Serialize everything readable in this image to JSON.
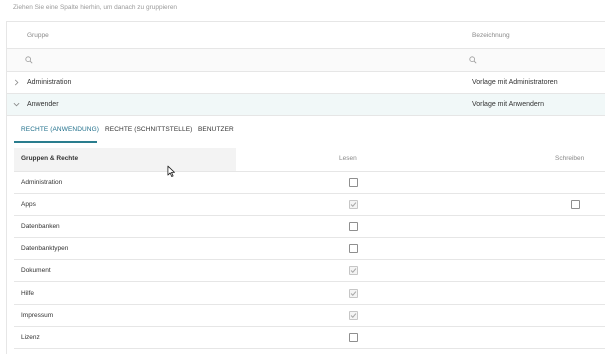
{
  "group_hint": "Ziehen Sie eine Spalte hierhin, um danach zu gruppieren",
  "columns": {
    "gruppe": "Gruppe",
    "bezeichnung": "Bezeichnung"
  },
  "groups": [
    {
      "name": "Administration",
      "description": "Vorlage mit Administratoren",
      "expanded": false
    },
    {
      "name": "Anwender",
      "description": "Vorlage mit Anwendern",
      "expanded": true
    }
  ],
  "tabs": [
    {
      "label": "RECHTE (ANWENDUNG)",
      "active": true
    },
    {
      "label": "RECHTE (SCHNITTSTELLE)",
      "active": false
    },
    {
      "label": "BENUTZER",
      "active": false
    }
  ],
  "rights_header": {
    "group": "Gruppen & Rechte",
    "read": "Lesen",
    "write": "Schreiben"
  },
  "rights": [
    {
      "name": "Administration",
      "read": false,
      "write": null
    },
    {
      "name": "Apps",
      "read": true,
      "write": false
    },
    {
      "name": "Datenbanken",
      "read": false,
      "write": null
    },
    {
      "name": "Datenbanktypen",
      "read": false,
      "write": null
    },
    {
      "name": "Dokument",
      "read": true,
      "write": null
    },
    {
      "name": "Hilfe",
      "read": true,
      "write": null
    },
    {
      "name": "Impressum",
      "read": true,
      "write": null
    },
    {
      "name": "Lizenz",
      "read": false,
      "write": null
    }
  ],
  "icons": {
    "search": "search-icon",
    "collapsed": "chevron-right-icon",
    "expanded": "chevron-down-icon",
    "cursor": "mouse-cursor-icon"
  },
  "colors": {
    "accent": "#2a7d8e",
    "selected_row": "#f1f8f8",
    "border": "#e6e6e6"
  }
}
